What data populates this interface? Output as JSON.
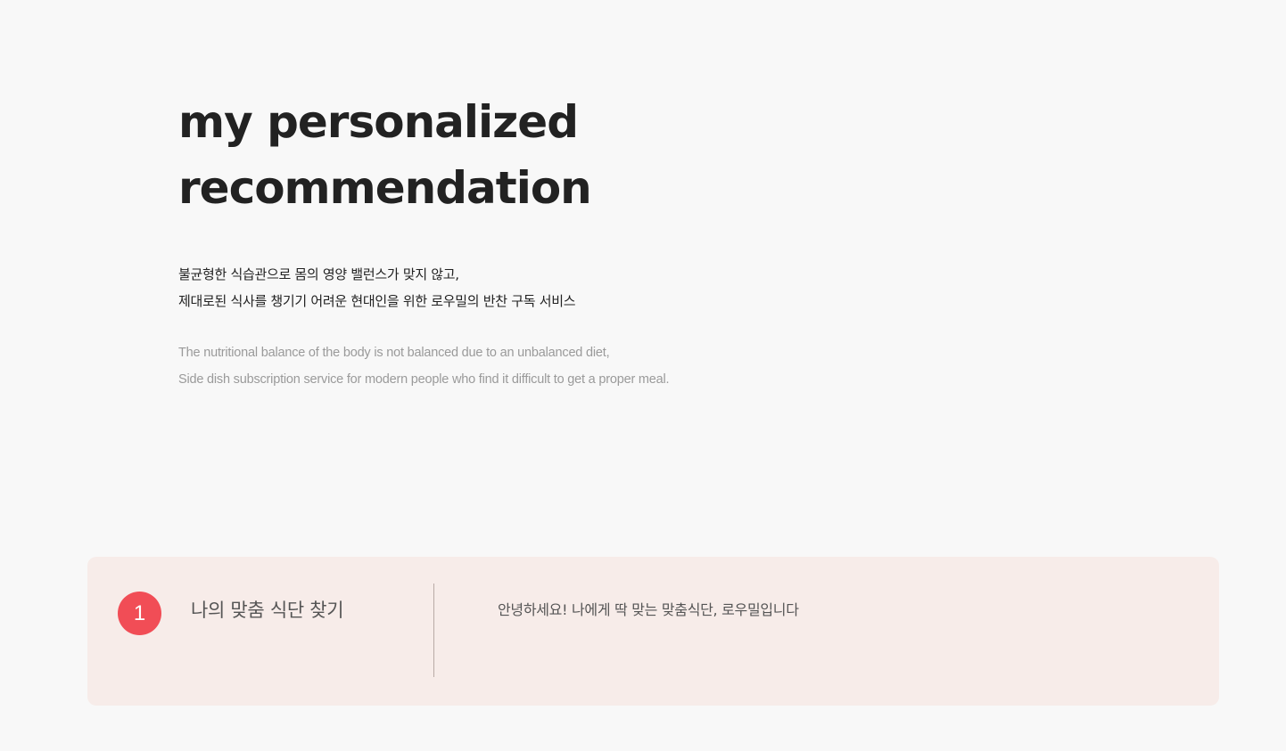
{
  "hero": {
    "title_line1": "my personalized",
    "title_line2": "recommendation"
  },
  "description_ko": [
    "불균형한 식습관으로 몸의 영양 밸런스가 맞지 않고,",
    "제대로된 식사를 챙기기 어려운 현대인을 위한 로우밀의 반찬 구독 서비스"
  ],
  "description_en": [
    "The nutritional balance of the body is not balanced due to an unbalanced diet,",
    "Side dish subscription service for modern people who find it difficult to get a proper meal."
  ],
  "step": {
    "number": "1",
    "title": "나의 맞춤 식단 찾기",
    "message": "안녕하세요! 나에게 딱 맞는 맞춤식단, 로우밀입니다"
  },
  "colors": {
    "background": "#f8f8f8",
    "card_background": "#f7ece9",
    "accent": "#f14d56",
    "title_text": "#222222",
    "muted_text": "#9a9a9a"
  }
}
